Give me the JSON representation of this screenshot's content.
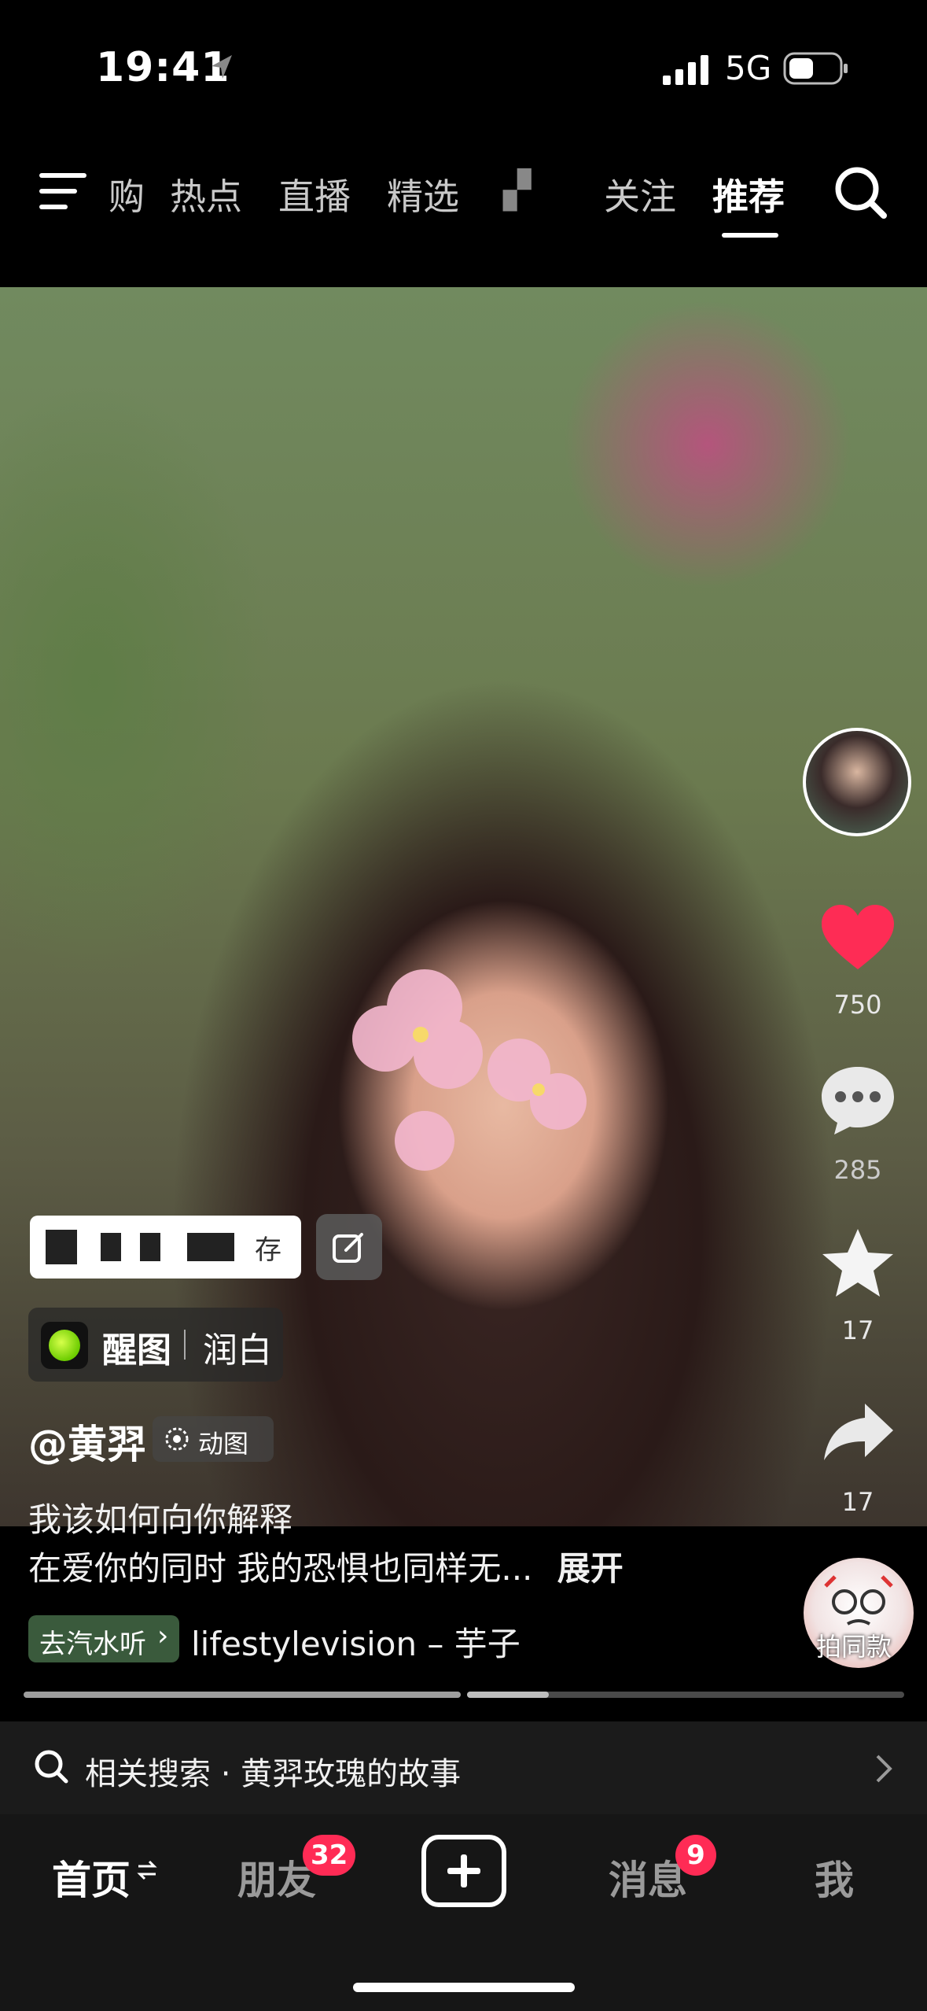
{
  "status_bar": {
    "time": "19:41",
    "network": "5G"
  },
  "top_nav": {
    "tabs": [
      {
        "label": "购"
      },
      {
        "label": "热点"
      },
      {
        "label": "直播"
      },
      {
        "label": "精选"
      },
      {
        "label": "▞"
      },
      {
        "label": "关注"
      },
      {
        "label": "推荐"
      }
    ],
    "active_tab": "推荐"
  },
  "rail": {
    "likes": "750",
    "comments": "285",
    "favorites": "17",
    "shares": "17",
    "like_color": "#fe2c55"
  },
  "overlay": {
    "save_label": "存",
    "app_name": "醒图",
    "filter_name": "润白",
    "author": "@黄羿",
    "gif_label": "动图",
    "desc_line1": "我该如何向你解释",
    "desc_line2": "在爱你的同时 我的恐惧也同样无...",
    "expand": "展开",
    "music_chip": "去汽水听",
    "music": "lifestylevision – 芋子",
    "same_style": "拍同款"
  },
  "related_search": {
    "text": "相关搜索 · 黄羿玫瑰的故事"
  },
  "bottom_nav": {
    "home": "首页",
    "friends": "朋友",
    "friends_badge": "32",
    "messages": "消息",
    "messages_badge": "9",
    "me": "我"
  }
}
